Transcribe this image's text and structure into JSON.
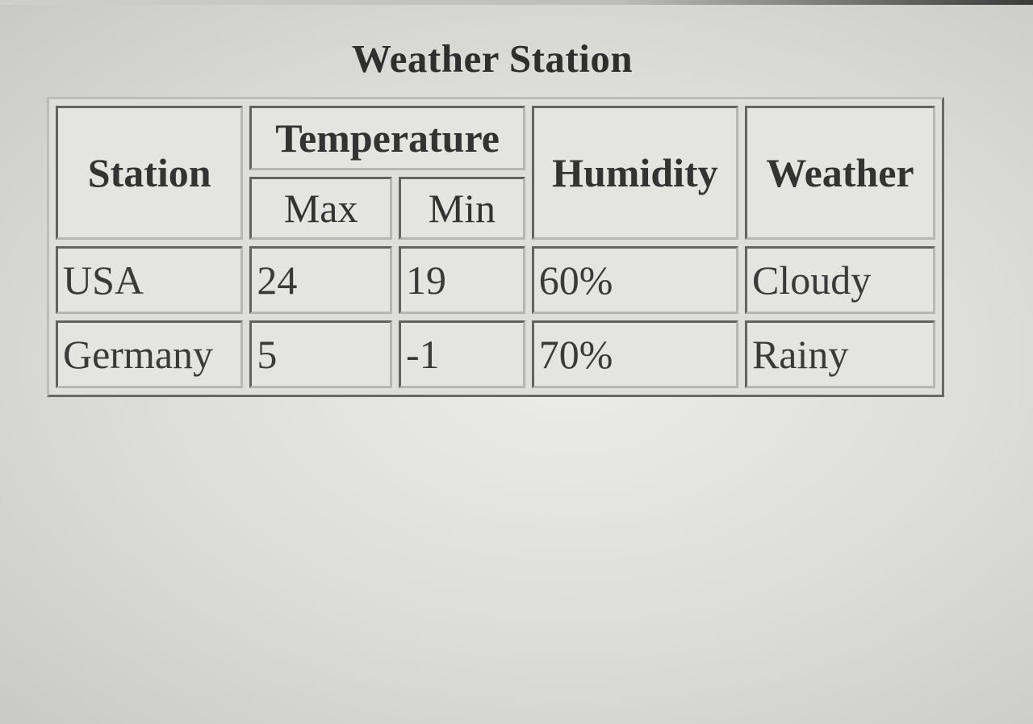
{
  "page": {
    "title": "Weather Station"
  },
  "table": {
    "headers": {
      "station": "Station",
      "temperature": "Temperature",
      "max": "Max",
      "min": "Min",
      "humidity": "Humidity",
      "weather": "Weather"
    },
    "rows": [
      {
        "station": "USA",
        "max": "24",
        "min": "19",
        "humidity": "60%",
        "weather": "Cloudy"
      },
      {
        "station": "Germany",
        "max": "5",
        "min": "-1",
        "humidity": "70%",
        "weather": "Rainy"
      }
    ]
  }
}
